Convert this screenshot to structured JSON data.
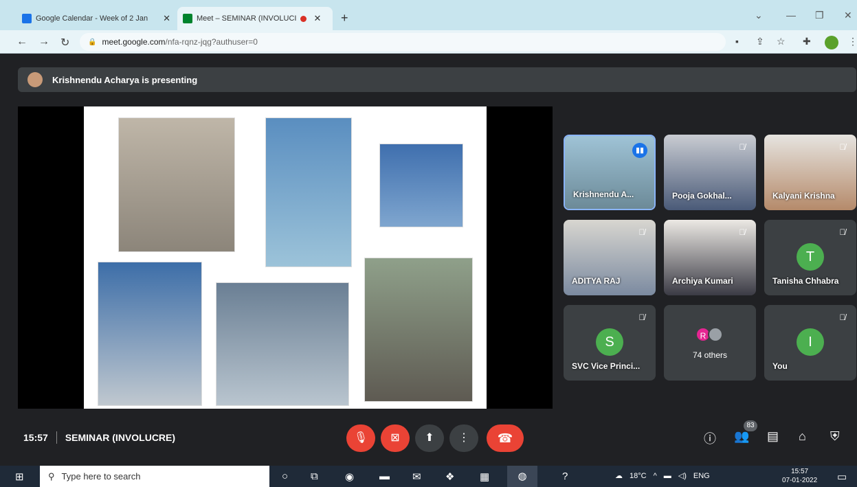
{
  "browser": {
    "tabs": [
      {
        "label": "Google Calendar - Week of 2 Jan",
        "icon": "calendar-icon"
      },
      {
        "label": "Meet – SEMINAR (INVOLUCI",
        "icon": "meet-icon"
      }
    ],
    "url_domain": "meet.google.com",
    "url_path": "/nfa-rqnz-jqg?authuser=0"
  },
  "meet": {
    "presenting_text": "Krishnendu Acharya is presenting",
    "time": "15:57",
    "meeting_title": "SEMINAR (INVOLUCRE)",
    "people_count": "83",
    "participants": [
      {
        "name": "Krishnendu A...",
        "muted": false,
        "speaking": true
      },
      {
        "name": "Pooja Gokhal...",
        "muted": true
      },
      {
        "name": "Kalyani Krishna",
        "muted": true
      },
      {
        "name": "ADITYA RAJ",
        "muted": true
      },
      {
        "name": "Archiya Kumari",
        "muted": true
      },
      {
        "name": "Tanisha Chhabra",
        "muted": true,
        "letter": "T"
      },
      {
        "name": "SVC Vice Princi...",
        "muted": true,
        "letter": "S"
      },
      {
        "name": "74 others",
        "avatar_letter": "R"
      },
      {
        "name": "You",
        "muted": true,
        "letter": "I"
      }
    ],
    "colors": {
      "end_call": "#ea4335",
      "speaking": "#1a73e8",
      "avatar": "#4caf50"
    }
  },
  "taskbar": {
    "search_placeholder": "Type here to search",
    "weather": "18°C",
    "lang": "ENG",
    "clock_time": "15:57",
    "clock_date": "07-01-2022"
  }
}
